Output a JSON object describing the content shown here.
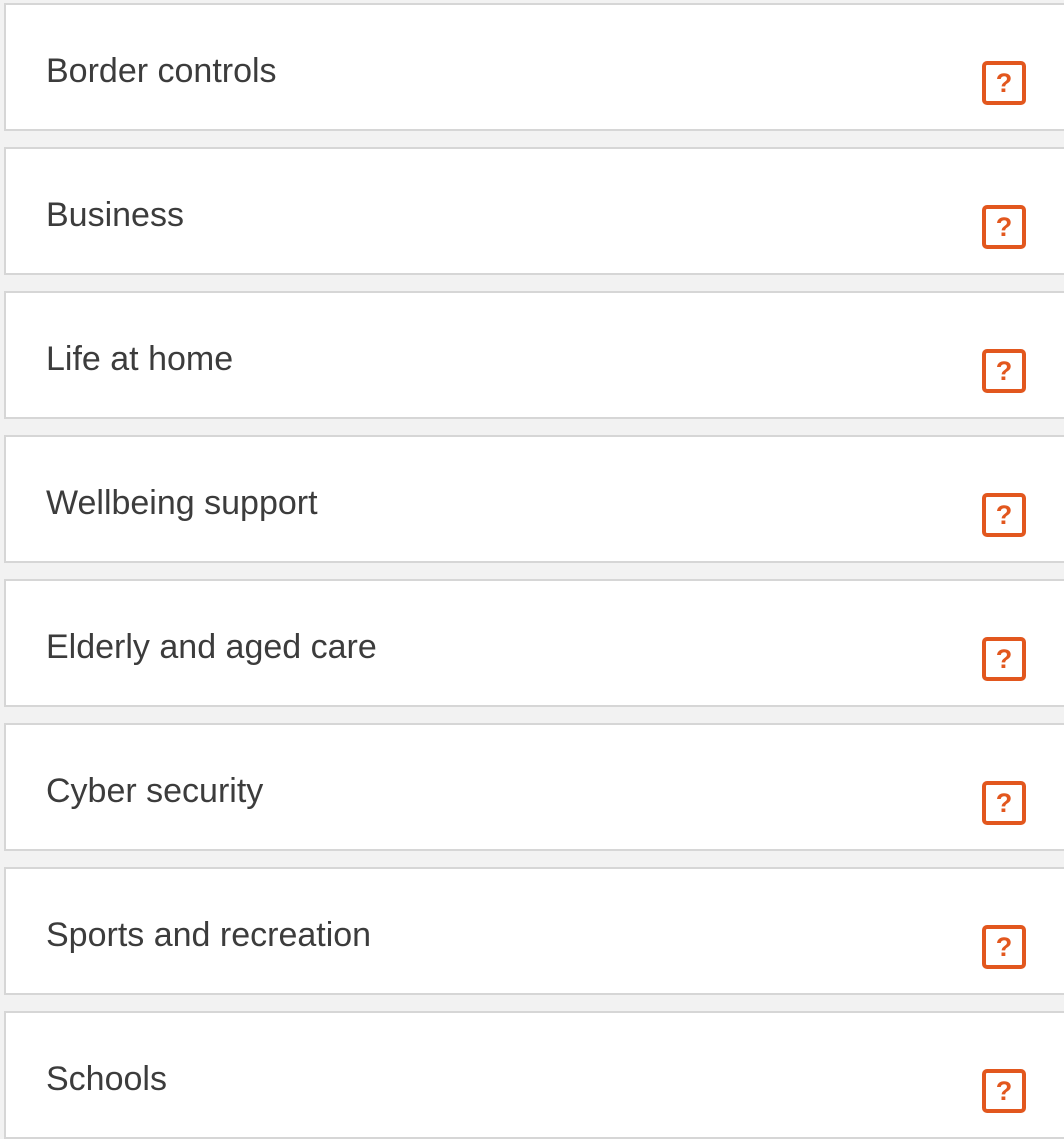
{
  "items": [
    {
      "label": "Border controls",
      "help_icon": "question-mark-icon",
      "help_glyph": "?"
    },
    {
      "label": "Business",
      "help_icon": "question-mark-icon",
      "help_glyph": "?"
    },
    {
      "label": "Life at home",
      "help_icon": "question-mark-icon",
      "help_glyph": "?"
    },
    {
      "label": "Wellbeing support",
      "help_icon": "question-mark-icon",
      "help_glyph": "?"
    },
    {
      "label": "Elderly and aged care",
      "help_icon": "question-mark-icon",
      "help_glyph": "?"
    },
    {
      "label": "Cyber security",
      "help_icon": "question-mark-icon",
      "help_glyph": "?"
    },
    {
      "label": "Sports and recreation",
      "help_icon": "question-mark-icon",
      "help_glyph": "?"
    },
    {
      "label": "Schools",
      "help_icon": "question-mark-icon",
      "help_glyph": "?"
    }
  ],
  "colors": {
    "accent": "#e2571e",
    "text": "#3c3c3c",
    "card_background": "#ffffff",
    "card_border": "#d6d6d6",
    "page_background": "#f2f2f2"
  }
}
